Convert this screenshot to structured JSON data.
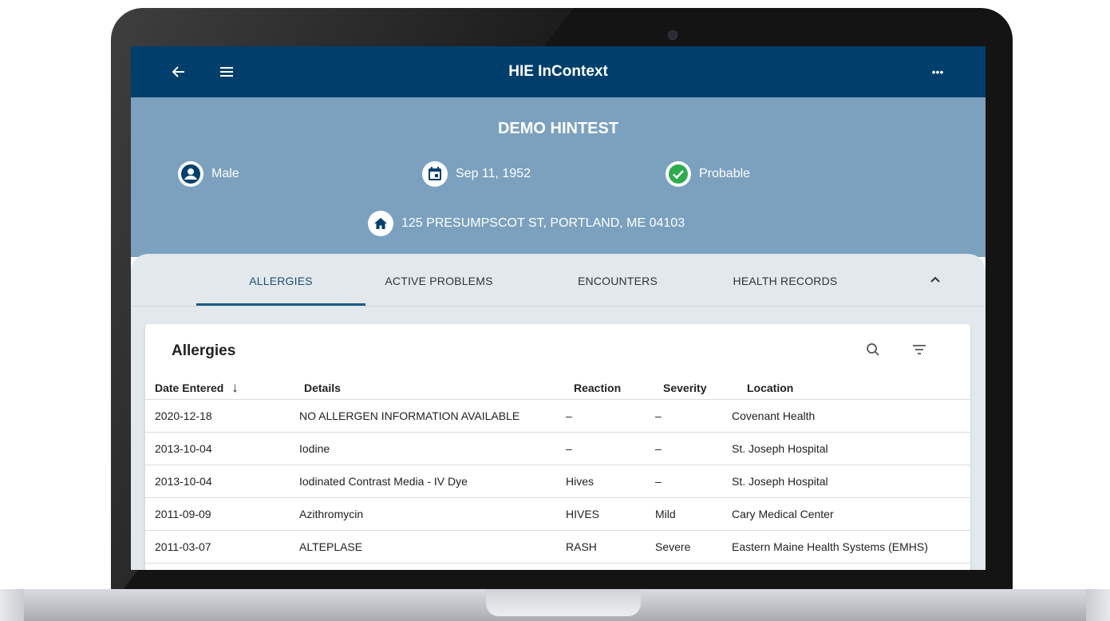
{
  "app": {
    "title": "HIE InContext",
    "more_label": "•••"
  },
  "patient": {
    "name": "DEMO HINTEST",
    "gender": "Male",
    "dob": "Sep 11, 1952",
    "match_status": "Probable",
    "address": "125 PRESUMPSCOT ST, PORTLAND, ME 04103"
  },
  "tabs": [
    {
      "label": "ALLERGIES",
      "active": true
    },
    {
      "label": "ACTIVE PROBLEMS",
      "active": false
    },
    {
      "label": "ENCOUNTERS",
      "active": false
    },
    {
      "label": "HEALTH RECORDS",
      "active": false
    }
  ],
  "allergies": {
    "title": "Allergies",
    "columns": [
      "Date Entered",
      "Details",
      "Reaction",
      "Severity",
      "Location"
    ],
    "sort_indicator": "↓",
    "rows": [
      [
        "2020-12-18",
        "NO ALLERGEN INFORMATION AVAILABLE",
        "–",
        "–",
        "Covenant Health"
      ],
      [
        "2013-10-04",
        "Iodine",
        "–",
        "–",
        "St. Joseph Hospital"
      ],
      [
        "2013-10-04",
        "Iodinated Contrast Media - IV Dye",
        "Hives",
        "–",
        "St. Joseph Hospital"
      ],
      [
        "2011-09-09",
        "Azithromycin",
        "HIVES",
        "Mild",
        "Cary Medical Center"
      ],
      [
        "2011-03-07",
        "ALTEPLASE",
        "RASH",
        "Severe",
        "Eastern Maine Health Systems (EMHS)"
      ]
    ]
  },
  "colors": {
    "appbar": "#003f6b",
    "banner": "#7ba1bf",
    "tab_indicator": "#1d5a86",
    "status_ok": "#2eaa4f"
  },
  "icons": {
    "back": "arrow-left",
    "menu": "hamburger",
    "more": "ellipsis",
    "gender": "account-circle",
    "dob": "calendar",
    "status": "check-circle",
    "address": "home",
    "collapse": "chevron-up",
    "search": "magnifier",
    "filter": "filter-lines",
    "sort": "arrow-down"
  }
}
